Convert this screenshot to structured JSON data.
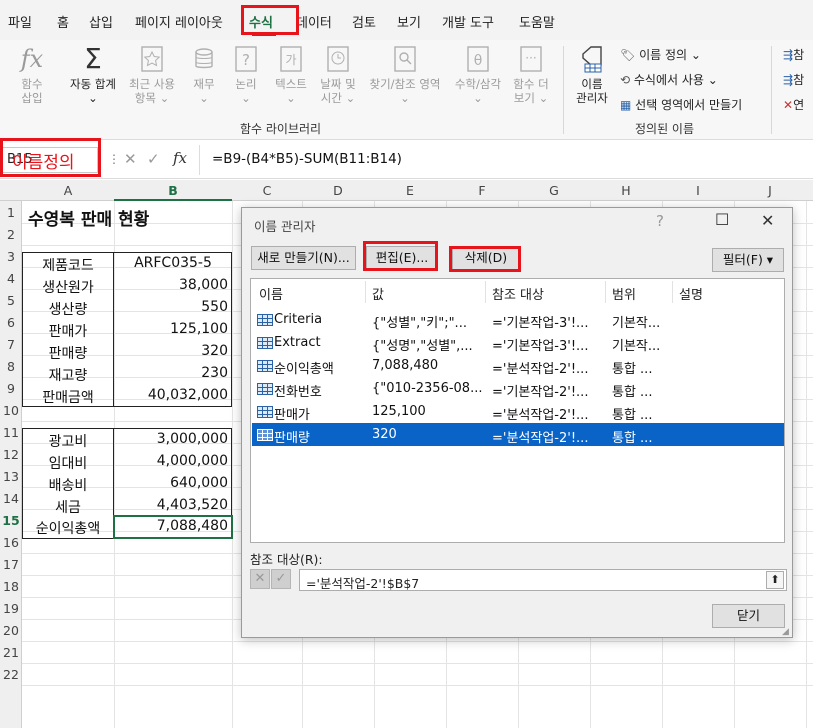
{
  "ribbon_tabs": [
    "파일",
    "홈",
    "삽입",
    "페이지 레이아웃",
    "수식",
    "데이터",
    "검토",
    "보기",
    "개발 도구",
    "도움말"
  ],
  "active_tab": "수식",
  "ribbon": {
    "insert_function": [
      "함수",
      "삽입"
    ],
    "autosum": [
      "자동 합계",
      "⌄"
    ],
    "recent": [
      "최근 사용",
      "항목 ⌄"
    ],
    "financial": [
      "재무",
      "⌄"
    ],
    "logical": [
      "논리",
      "⌄"
    ],
    "text": [
      "텍스트",
      "⌄"
    ],
    "datetime": [
      "날짜 및",
      "시간 ⌄"
    ],
    "lookup": [
      "찾기/참조 영역",
      "⌄"
    ],
    "math": [
      "수학/삼각",
      "⌄"
    ],
    "more": [
      "함수 더",
      "보기 ⌄"
    ],
    "group_library": "함수 라이브러리",
    "name_manager": [
      "이름",
      "관리자"
    ],
    "define_name": "이름 정의  ⌄",
    "use_in_formula": "수식에서 사용 ⌄",
    "create_from_selection": "선택 영역에서 만들기",
    "group_defined": "정의된 이름",
    "trace1": "참",
    "trace2": "참",
    "trace3": "연"
  },
  "formula_bar": {
    "name_box": "B15",
    "annotation": "이름정의",
    "fx": "fx",
    "formula": "=B9-(B4*B5)-SUM(B11:B14)"
  },
  "columns": [
    "A",
    "B",
    "C",
    "D",
    "E",
    "F",
    "G",
    "H",
    "I",
    "J"
  ],
  "rows": [
    "1",
    "2",
    "3",
    "4",
    "5",
    "6",
    "7",
    "8",
    "9",
    "10",
    "11",
    "12",
    "13",
    "14",
    "15",
    "16",
    "17",
    "18",
    "19",
    "20",
    "21",
    "22"
  ],
  "sheet": {
    "title": "수영복 판매 현황",
    "r3": [
      "제품코드",
      "ARFC035-5"
    ],
    "r4": [
      "생산원가",
      "38,000"
    ],
    "r5": [
      "생산량",
      "550"
    ],
    "r6": [
      "판매가",
      "125,100"
    ],
    "r7": [
      "판매량",
      "320"
    ],
    "r8": [
      "재고량",
      "230"
    ],
    "r9": [
      "판매금액",
      "40,032,000"
    ],
    "r11": [
      "광고비",
      "3,000,000"
    ],
    "r12": [
      "임대비",
      "4,000,000"
    ],
    "r13": [
      "배송비",
      "640,000"
    ],
    "r14": [
      "세금",
      "4,403,520"
    ],
    "r15": [
      "순이익총액",
      "7,088,480"
    ]
  },
  "dialog": {
    "title": "이름 관리자",
    "btn_new": "새로 만들기(N)...",
    "btn_edit": "편집(E)...",
    "btn_delete": "삭제(D)",
    "btn_filter": "필터(F) ▾",
    "headers": [
      "이름",
      "값",
      "참조 대상",
      "범위",
      "설명"
    ],
    "rows": [
      {
        "name": "Criteria",
        "value": "{\"성별\",\"키\";\"...",
        "ref": "='기본작업-3'!...",
        "scope": "기본작..."
      },
      {
        "name": "Extract",
        "value": "{\"성명\",\"성별\",...",
        "ref": "='기본작업-3'!...",
        "scope": "기본작..."
      },
      {
        "name": "순이익총액",
        "value": "7,088,480",
        "ref": "='분석작업-2'!...",
        "scope": "통합 ..."
      },
      {
        "name": "전화번호",
        "value": "{\"010-2356-08...",
        "ref": "='기본작업-2'!...",
        "scope": "통합 ..."
      },
      {
        "name": "판매가",
        "value": "125,100",
        "ref": "='분석작업-2'!...",
        "scope": "통합 ..."
      },
      {
        "name": "판매량",
        "value": "320",
        "ref": "='분석작업-2'!...",
        "scope": "통합 ..."
      }
    ],
    "selected_index": 5,
    "ref_label": "참조 대상(R):",
    "ref_value": "='분석작업-2'!$B$7",
    "btn_close": "닫기"
  },
  "colors": {
    "accent": "#1e7145",
    "highlight": "#e8141b",
    "selection": "#0a64c8"
  }
}
